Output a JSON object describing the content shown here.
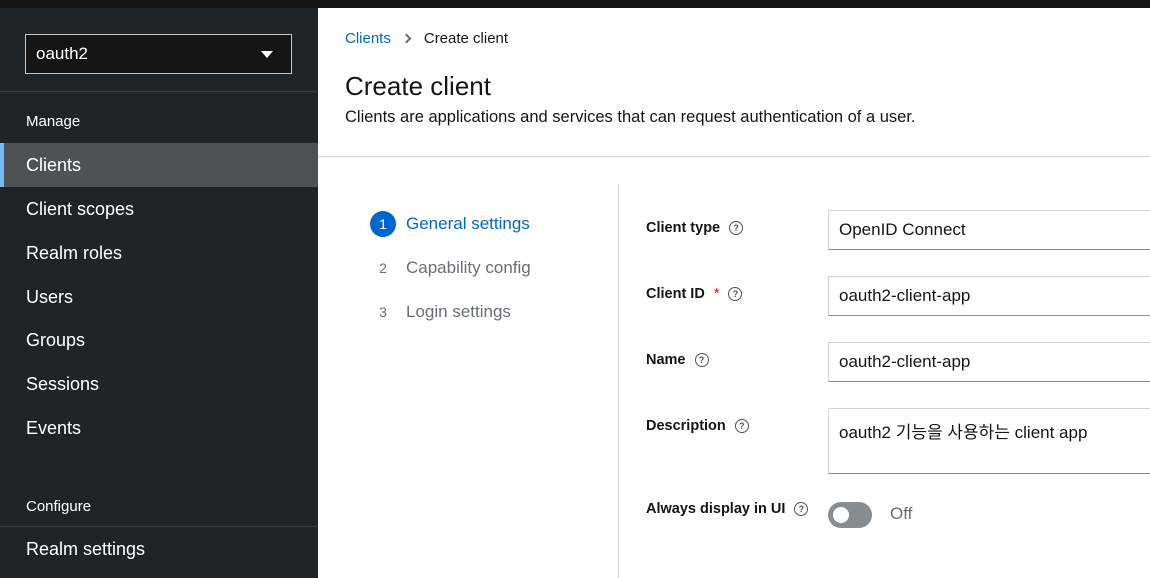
{
  "sidebar": {
    "realm_selector": {
      "value": "oauth2"
    },
    "sections": {
      "manage": "Manage",
      "configure": "Configure"
    },
    "items": [
      {
        "label": "Clients",
        "active": true
      },
      {
        "label": "Client scopes"
      },
      {
        "label": "Realm roles"
      },
      {
        "label": "Users"
      },
      {
        "label": "Groups"
      },
      {
        "label": "Sessions"
      },
      {
        "label": "Events"
      },
      {
        "label": "Realm settings"
      }
    ]
  },
  "breadcrumb": {
    "parent": "Clients",
    "current": "Create client"
  },
  "page": {
    "title": "Create client",
    "description": "Clients are applications and services that can request authentication of a user."
  },
  "wizard": {
    "steps": [
      {
        "number": "1",
        "label": "General settings",
        "current": true
      },
      {
        "number": "2",
        "label": "Capability config"
      },
      {
        "number": "3",
        "label": "Login settings"
      }
    ]
  },
  "form": {
    "client_type": {
      "label": "Client type",
      "value": "OpenID Connect"
    },
    "client_id": {
      "label": "Client ID",
      "required_mark": "*",
      "value": "oauth2-client-app"
    },
    "name": {
      "label": "Name",
      "value": "oauth2-client-app"
    },
    "description": {
      "label": "Description",
      "value": "oauth2 기능을 사용하는 client app"
    },
    "always_display": {
      "label": "Always display in UI",
      "state": "Off"
    },
    "help_glyph": "?"
  },
  "colors": {
    "sidebar_bg": "#212427",
    "active_nav_bg": "#4f5255",
    "active_nav_accent": "#73bcf7",
    "link_blue": "#0066cc",
    "required_red": "#c9190b"
  }
}
